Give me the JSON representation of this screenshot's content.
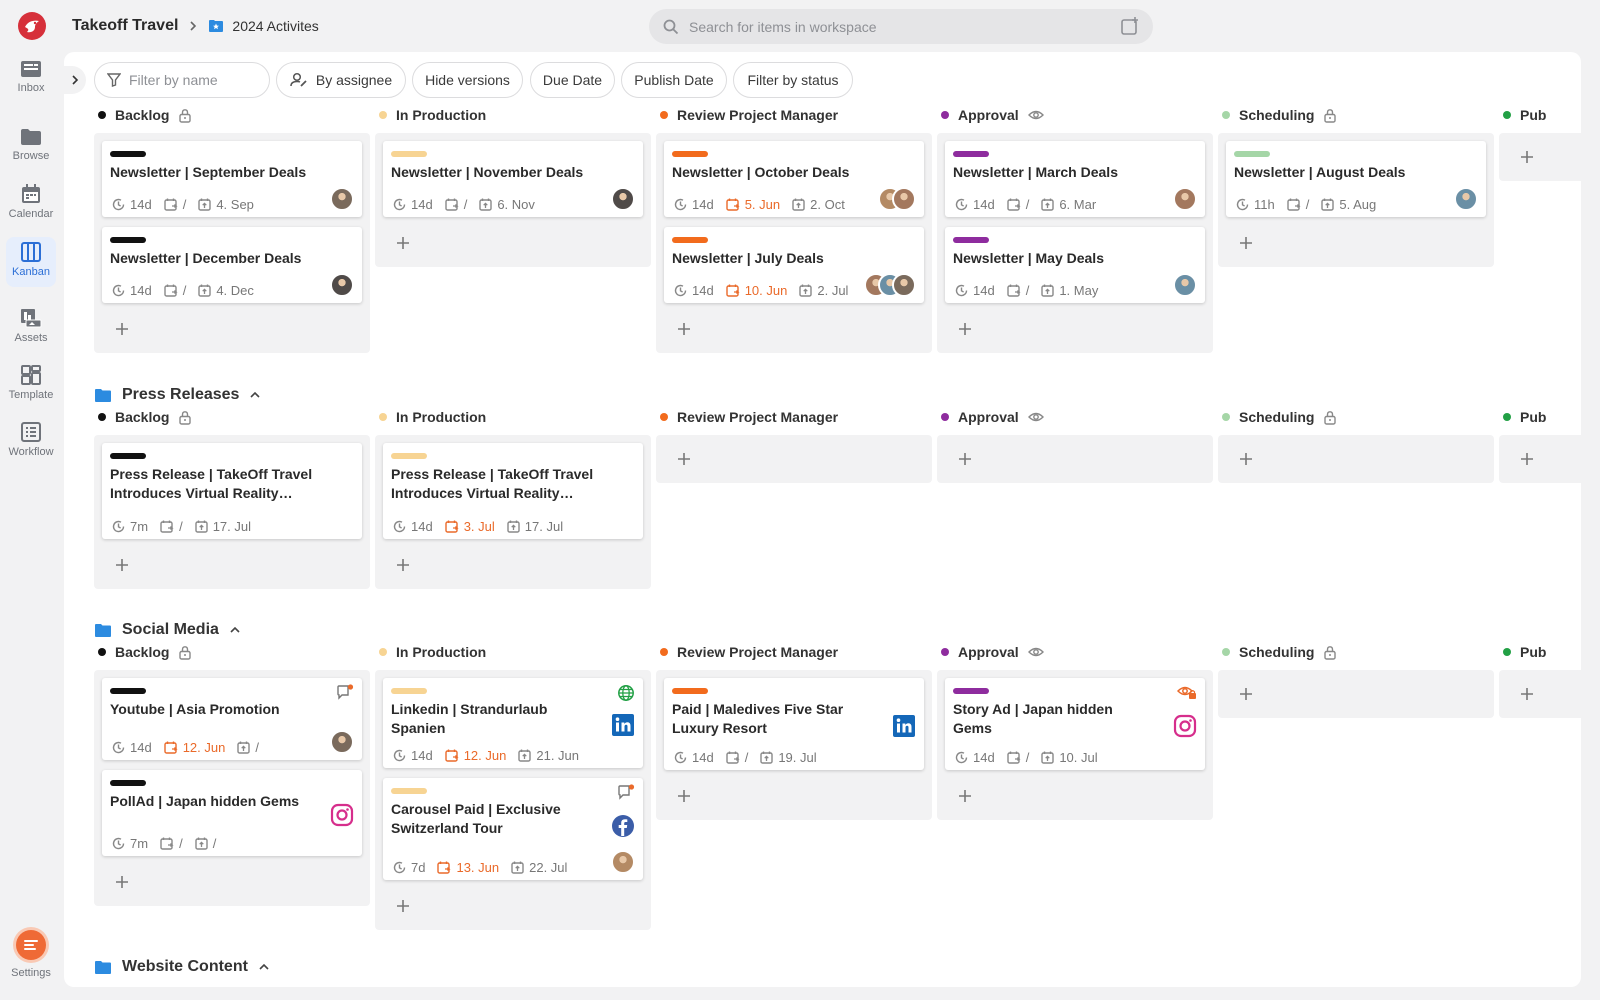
{
  "nav": {
    "items": [
      {
        "label": "Inbox",
        "icon": "inbox-icon"
      },
      {
        "label": "Browse",
        "icon": "folder-icon"
      },
      {
        "label": "Calendar",
        "icon": "calendar-icon"
      },
      {
        "label": "Kanban",
        "icon": "kanban-icon",
        "active": true
      },
      {
        "label": "Assets",
        "icon": "assets-icon"
      },
      {
        "label": "Template",
        "icon": "template-icon"
      },
      {
        "label": "Workflow",
        "icon": "workflow-icon"
      }
    ],
    "settings_label": "Settings"
  },
  "header": {
    "workspace": "Takeoff Travel",
    "separator": ">",
    "project": "2024 Activites",
    "search_placeholder": "Search for items in workspace"
  },
  "filters": {
    "name_placeholder": "Filter by name",
    "assignee": "By assignee",
    "hide_versions": "Hide versions",
    "due_date": "Due Date",
    "publish_date": "Publish Date",
    "status": "Filter by status"
  },
  "colors": {
    "accent": "#2c6fd6",
    "due": "#ea6a2a",
    "status": {
      "Backlog": "#111111",
      "In Production": "#f7d493",
      "Review Project Manager": "#f26b1d",
      "Approval": "#8e2c9e",
      "Scheduling": "#a5d6a7",
      "Publish": "#22a045"
    }
  },
  "sections": [
    {
      "name": "",
      "columns": [
        {
          "title": "Backlog",
          "icon": "lock-icon",
          "cards": [
            {
              "title": "Newsletter | September Deals",
              "time": "14d",
              "due": "/",
              "publish": "4. Sep",
              "avatars": 1
            },
            {
              "title": "Newsletter | December Deals",
              "time": "14d",
              "due": "/",
              "publish": "4. Dec",
              "avatars": 1
            }
          ]
        },
        {
          "title": "In Production",
          "icon": "",
          "cards": [
            {
              "title": "Newsletter | November Deals",
              "time": "14d",
              "due": "/",
              "publish": "6. Nov",
              "avatars": 1
            }
          ]
        },
        {
          "title": "Review Project Manager",
          "icon": "",
          "cards": [
            {
              "title": "Newsletter | October Deals",
              "time": "14d",
              "due": "5. Jun",
              "publish": "2. Oct",
              "avatars": 2
            },
            {
              "title": "Newsletter | July Deals",
              "time": "14d",
              "due": "10. Jun",
              "publish": "2. Jul",
              "avatars": 3
            }
          ]
        },
        {
          "title": "Approval",
          "icon": "eye-icon",
          "cards": [
            {
              "title": "Newsletter | March Deals",
              "time": "14d",
              "due": "/",
              "publish": "6. Mar",
              "avatars": 1
            },
            {
              "title": "Newsletter | May Deals",
              "time": "14d",
              "due": "/",
              "publish": "1. May",
              "avatars": 1
            }
          ]
        },
        {
          "title": "Scheduling",
          "icon": "lock-icon",
          "cards": [
            {
              "title": "Newsletter | August Deals",
              "time": "11h",
              "due": "/",
              "publish": "5. Aug",
              "avatars": 1
            }
          ]
        },
        {
          "title": "Pub",
          "icon": "",
          "cards": []
        }
      ]
    },
    {
      "name": "Press Releases",
      "columns": [
        {
          "title": "Backlog",
          "icon": "lock-icon",
          "cards": [
            {
              "title": "Press Release | TakeOff Travel Introduces Virtual Reality Previews...",
              "time": "7m",
              "due": "/",
              "publish": "17. Jul"
            }
          ]
        },
        {
          "title": "In Production",
          "icon": "",
          "cards": [
            {
              "title": "Press Release | TakeOff Travel Introduces Virtual Reality Previews...",
              "time": "14d",
              "due": "3. Jul",
              "publish": "17. Jul"
            }
          ]
        },
        {
          "title": "Review Project Manager",
          "icon": "",
          "cards": []
        },
        {
          "title": "Approval",
          "icon": "eye-icon",
          "cards": []
        },
        {
          "title": "Scheduling",
          "icon": "lock-icon",
          "cards": []
        },
        {
          "title": "Pub",
          "icon": "",
          "cards": []
        }
      ]
    },
    {
      "name": "Social Media",
      "columns": [
        {
          "title": "Backlog",
          "icon": "lock-icon",
          "cards": [
            {
              "title": "Youtube | Asia Promotion",
              "time": "14d",
              "due": "12. Jun",
              "publish": "/",
              "avatars": 1,
              "topicon": "comment-icon"
            },
            {
              "title": "PollAd | Japan hidden Gems",
              "time": "7m",
              "due": "/",
              "publish": "/",
              "social": "instagram-icon"
            }
          ]
        },
        {
          "title": "In Production",
          "icon": "",
          "cards": [
            {
              "title": "Linkedin | Strandurlaub Spanien",
              "time": "14d",
              "due": "12. Jun",
              "publish": "21. Jun",
              "social": "linkedin-icon",
              "topicon": "globe-icon"
            },
            {
              "title": "Carousel Paid | Exclusive Switzerland Tour",
              "time": "7d",
              "due": "13. Jun",
              "publish": "22. Jul",
              "social": "facebook-icon",
              "avatars": 1,
              "topicon": "comment-icon"
            }
          ]
        },
        {
          "title": "Review Project Manager",
          "icon": "",
          "cards": [
            {
              "title": "Paid | Maledives Five Star Luxury Resort",
              "time": "14d",
              "due": "/",
              "publish": "19. Jul",
              "social": "linkedin-icon"
            }
          ]
        },
        {
          "title": "Approval",
          "icon": "eye-icon",
          "cards": [
            {
              "title": "Story Ad | Japan hidden Gems",
              "time": "14d",
              "due": "/",
              "publish": "10. Jul",
              "social": "instagram-icon",
              "topicon": "eye-lock-icon"
            }
          ]
        },
        {
          "title": "Scheduling",
          "icon": "lock-icon",
          "cards": []
        },
        {
          "title": "Pub",
          "icon": "",
          "cards": []
        }
      ]
    },
    {
      "name": "Website Content",
      "columns": []
    }
  ]
}
